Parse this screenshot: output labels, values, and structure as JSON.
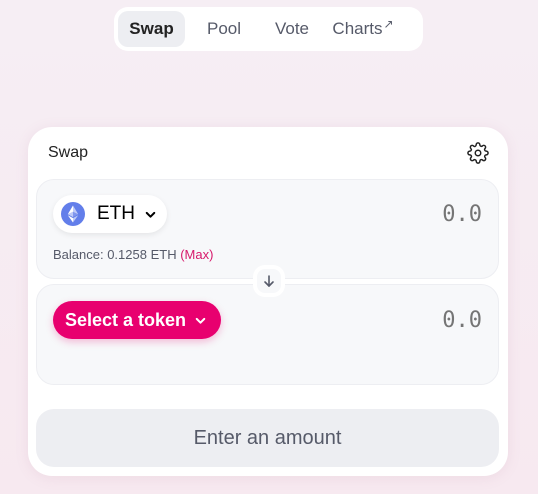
{
  "nav": {
    "tabs": [
      {
        "label": "Swap",
        "active": true
      },
      {
        "label": "Pool",
        "active": false
      },
      {
        "label": "Vote",
        "active": false
      },
      {
        "label": "Charts",
        "active": false,
        "external_icon": "↗"
      }
    ]
  },
  "swap": {
    "title": "Swap",
    "settings_icon": "gear-icon",
    "input": {
      "token": "ETH",
      "token_icon": "ethereum-icon",
      "amount_placeholder": "0.0",
      "balance_label": "Balance: 0.1258 ETH",
      "max_label": "(Max)"
    },
    "switch_icon": "arrow-down-icon",
    "output": {
      "select_label": "Select a token",
      "amount_placeholder": "0.0"
    },
    "cta_label": "Enter an amount"
  },
  "colors": {
    "accent": "#e8006f",
    "max_link": "#d6196b",
    "panel_bg": "#f7f8fa",
    "button_disabled_bg": "#edeef2"
  }
}
